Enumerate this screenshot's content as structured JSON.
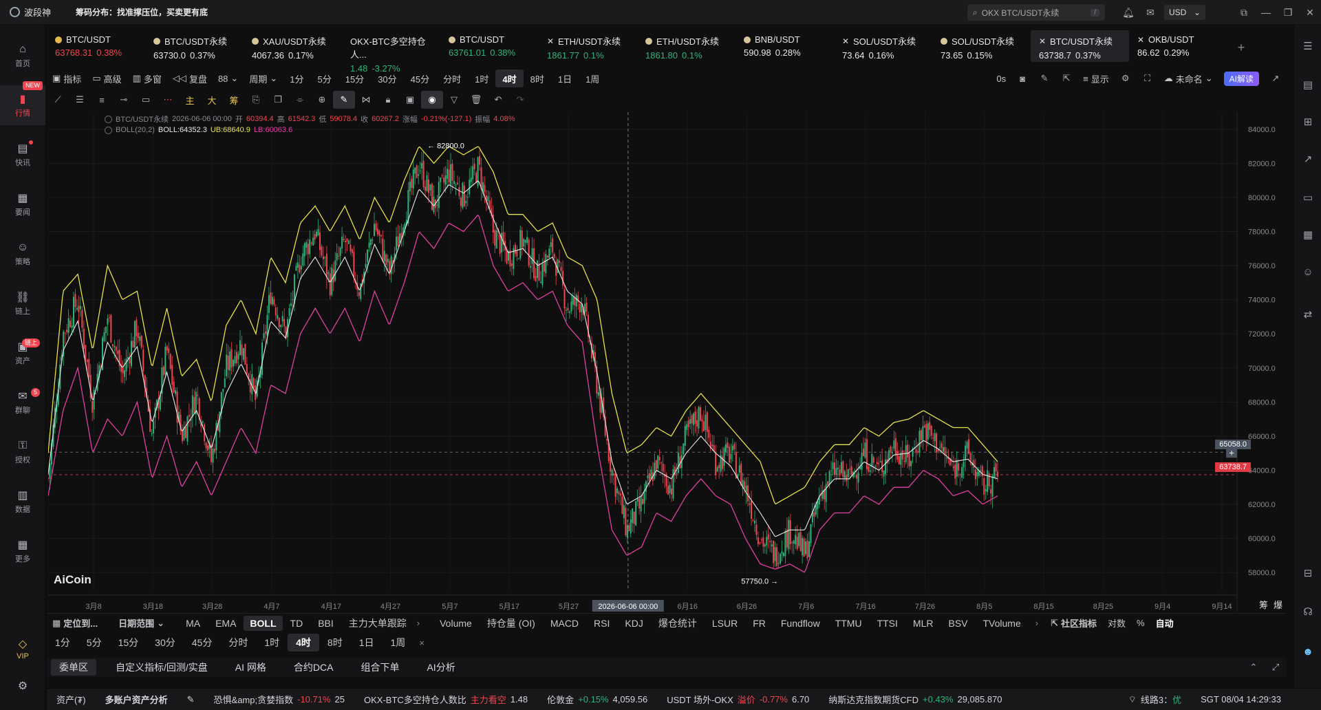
{
  "app": {
    "name": "波段神",
    "slogan": "筹码分布：找准撑压位，买卖更有底"
  },
  "titlebar": {
    "search_placeholder": "OKX BTC/USDT永续",
    "search_key": "/",
    "currency": "USD"
  },
  "leftbar": [
    {
      "label": "首页",
      "icon": "home-icon"
    },
    {
      "label": "行情",
      "icon": "chart-bar-icon",
      "active": true,
      "badge": "NEW"
    },
    {
      "label": "快讯",
      "icon": "news-icon",
      "dot": true
    },
    {
      "label": "要闻",
      "icon": "document-icon"
    },
    {
      "label": "策略",
      "icon": "robot-icon"
    },
    {
      "label": "链上",
      "icon": "chain-icon"
    },
    {
      "label": "资产",
      "icon": "wallet-icon",
      "badge": "链上"
    },
    {
      "label": "群聊",
      "icon": "chat-icon",
      "badge": "5"
    },
    {
      "label": "授权",
      "icon": "key-icon"
    },
    {
      "label": "数据",
      "icon": "data-icon"
    },
    {
      "label": "更多",
      "icon": "grid-icon"
    }
  ],
  "vip": "VIP",
  "tabs": [
    {
      "name": "BTC/USDT",
      "price": "63768.31",
      "change": "0.38%",
      "dir": "up",
      "icon": "coin"
    },
    {
      "name": "BTC/USDT永续",
      "price": "63730.0",
      "change": "0.37%",
      "dir": "neutral",
      "icon": "dot"
    },
    {
      "name": "XAU/USDT永续",
      "price": "4067.36",
      "change": "0.17%",
      "dir": "neutral",
      "icon": "dot"
    },
    {
      "name": "OKX-BTC多空持仓人...",
      "price": "1.48",
      "change": "-3.27%",
      "dir": "down",
      "icon": "none"
    },
    {
      "name": "BTC/USDT",
      "price": "63761.01",
      "change": "0.38%",
      "dir": "down",
      "icon": "dot"
    },
    {
      "name": "ETH/USDT永续",
      "price": "1861.77",
      "change": "0.1%",
      "dir": "down",
      "icon": "x"
    },
    {
      "name": "ETH/USDT永续",
      "price": "1861.80",
      "change": "0.1%",
      "dir": "down",
      "icon": "dot"
    },
    {
      "name": "BNB/USDT",
      "price": "590.98",
      "change": "0.28%",
      "dir": "neutral",
      "icon": "dot"
    },
    {
      "name": "SOL/USDT永续",
      "price": "73.64",
      "change": "0.16%",
      "dir": "neutral",
      "icon": "x"
    },
    {
      "name": "SOL/USDT永续",
      "price": "73.65",
      "change": "0.15%",
      "dir": "neutral",
      "icon": "dot"
    },
    {
      "name": "BTC/USDT永续",
      "price": "63738.7",
      "change": "0.37%",
      "dir": "neutral",
      "icon": "x",
      "active": true
    },
    {
      "name": "OKB/USDT",
      "price": "86.62",
      "change": "0.29%",
      "dir": "neutral",
      "icon": "x"
    }
  ],
  "toolbar1": {
    "indicator": "指标",
    "advanced": "高级",
    "multi": "多窗",
    "replay": "复盘",
    "layout": "88",
    "period_label": "周期",
    "periods": [
      "1分",
      "5分",
      "15分",
      "30分",
      "45分",
      "分时",
      "1时",
      "4时",
      "8时",
      "1日",
      "1周"
    ],
    "selected_period": "4时",
    "countdown": "0s",
    "display": "显示",
    "unnamed": "未命名",
    "ai": "AI解读"
  },
  "toolbar2_quick": [
    "主",
    "大",
    "筹"
  ],
  "chart_legend": {
    "symbol": "BTC/USDT永续",
    "date": "2026-06-06 00:00",
    "open_lbl": "开",
    "open": "60394.4",
    "high_lbl": "高",
    "high": "61542.3",
    "low_lbl": "低",
    "low": "59078.4",
    "close_lbl": "收",
    "close": "60267.2",
    "chg_lbl": "涨幅",
    "chg": "-0.21%(-127.1)",
    "amp_lbl": "振幅",
    "amp": "4.08%",
    "boll_name": "BOLL(20,2)",
    "boll_mid": "BOLL:64352.3",
    "boll_ub": "UB:68640.9",
    "boll_lb": "LB:60063.6"
  },
  "chart_data": {
    "type": "candlestick",
    "ylim": [
      57000,
      85000
    ],
    "y_ticks": [
      "84000.0",
      "82000.0",
      "80000.0",
      "78000.0",
      "76000.0",
      "74000.0",
      "72000.0",
      "70000.0",
      "68000.0",
      "66000.0",
      "64000.0",
      "62000.0",
      "60000.0",
      "58000.0"
    ],
    "x_ticks": [
      "3月8",
      "3月18",
      "3月28",
      "4月7",
      "4月17",
      "4月27",
      "5月7",
      "5月17",
      "5月27",
      "2026-06-06 00:00",
      "6月16",
      "6月26",
      "7月6",
      "7月16",
      "7月26",
      "8月5",
      "8月15",
      "8月25",
      "9月4",
      "9月14"
    ],
    "highlight_x": "2026-06-06 00:00",
    "close_path": [
      [
        0,
        63500
      ],
      [
        2,
        72000
      ],
      [
        4,
        74000
      ],
      [
        6,
        68000
      ],
      [
        8,
        73000
      ],
      [
        10,
        69500
      ],
      [
        12,
        72500
      ],
      [
        14,
        66000
      ],
      [
        16,
        71000
      ],
      [
        18,
        66000
      ],
      [
        20,
        68500
      ],
      [
        22,
        64500
      ],
      [
        24,
        70000
      ],
      [
        26,
        71500
      ],
      [
        28,
        68000
      ],
      [
        30,
        74500
      ],
      [
        32,
        72000
      ],
      [
        34,
        76500
      ],
      [
        36,
        78000
      ],
      [
        38,
        75000
      ],
      [
        40,
        77500
      ],
      [
        42,
        74500
      ],
      [
        44,
        78500
      ],
      [
        46,
        75500
      ],
      [
        48,
        79000
      ],
      [
        50,
        82000
      ],
      [
        52,
        79500
      ],
      [
        54,
        81500
      ],
      [
        56,
        80000
      ],
      [
        58,
        81800
      ],
      [
        60,
        78000
      ],
      [
        62,
        76500
      ],
      [
        64,
        77500
      ],
      [
        66,
        75500
      ],
      [
        68,
        77000
      ],
      [
        70,
        73500
      ],
      [
        72,
        74000
      ],
      [
        74,
        69000
      ],
      [
        76,
        64000
      ],
      [
        78,
        60500
      ],
      [
        80,
        62000
      ],
      [
        82,
        64500
      ],
      [
        84,
        63000
      ],
      [
        86,
        66000
      ],
      [
        88,
        67500
      ],
      [
        90,
        64500
      ],
      [
        92,
        65000
      ],
      [
        94,
        63000
      ],
      [
        96,
        60000
      ],
      [
        98,
        59000
      ],
      [
        100,
        60500
      ],
      [
        102,
        59000
      ],
      [
        104,
        62500
      ],
      [
        106,
        64000
      ],
      [
        108,
        63500
      ],
      [
        110,
        65000
      ],
      [
        112,
        64000
      ],
      [
        114,
        65500
      ],
      [
        116,
        64500
      ],
      [
        118,
        66500
      ],
      [
        120,
        65500
      ],
      [
        122,
        64000
      ],
      [
        124,
        65000
      ],
      [
        126,
        63000
      ],
      [
        128,
        63738
      ]
    ],
    "ub_path": [
      [
        0,
        65000
      ],
      [
        2,
        74500
      ],
      [
        4,
        75500
      ],
      [
        6,
        71000
      ],
      [
        8,
        76000
      ],
      [
        10,
        74000
      ],
      [
        12,
        74500
      ],
      [
        14,
        70000
      ],
      [
        16,
        73500
      ],
      [
        18,
        69500
      ],
      [
        20,
        70500
      ],
      [
        22,
        68000
      ],
      [
        24,
        72500
      ],
      [
        26,
        74000
      ],
      [
        28,
        72000
      ],
      [
        30,
        76500
      ],
      [
        32,
        75000
      ],
      [
        34,
        78500
      ],
      [
        36,
        79500
      ],
      [
        38,
        78000
      ],
      [
        40,
        79500
      ],
      [
        42,
        77500
      ],
      [
        44,
        80000
      ],
      [
        46,
        78500
      ],
      [
        48,
        81000
      ],
      [
        50,
        83000
      ],
      [
        52,
        82000
      ],
      [
        54,
        83000
      ],
      [
        56,
        82500
      ],
      [
        58,
        83000
      ],
      [
        60,
        81500
      ],
      [
        62,
        79000
      ],
      [
        64,
        79000
      ],
      [
        66,
        78000
      ],
      [
        68,
        78500
      ],
      [
        70,
        76500
      ],
      [
        72,
        76000
      ],
      [
        74,
        74000
      ],
      [
        76,
        68500
      ],
      [
        78,
        65000
      ],
      [
        80,
        65500
      ],
      [
        82,
        66500
      ],
      [
        84,
        66000
      ],
      [
        86,
        67500
      ],
      [
        88,
        68500
      ],
      [
        90,
        67500
      ],
      [
        92,
        66500
      ],
      [
        94,
        65500
      ],
      [
        96,
        64500
      ],
      [
        98,
        62000
      ],
      [
        100,
        62500
      ],
      [
        102,
        63000
      ],
      [
        104,
        64500
      ],
      [
        106,
        65500
      ],
      [
        108,
        65500
      ],
      [
        110,
        66500
      ],
      [
        112,
        66000
      ],
      [
        114,
        66800
      ],
      [
        116,
        67000
      ],
      [
        118,
        67500
      ],
      [
        120,
        67000
      ],
      [
        122,
        66500
      ],
      [
        124,
        66500
      ],
      [
        126,
        65500
      ],
      [
        128,
        64500
      ]
    ],
    "lb_path": [
      [
        0,
        62500
      ],
      [
        2,
        67500
      ],
      [
        4,
        70000
      ],
      [
        6,
        65000
      ],
      [
        8,
        67000
      ],
      [
        10,
        66000
      ],
      [
        12,
        68000
      ],
      [
        14,
        63500
      ],
      [
        16,
        66000
      ],
      [
        18,
        63000
      ],
      [
        20,
        64500
      ],
      [
        22,
        62500
      ],
      [
        24,
        64500
      ],
      [
        26,
        66500
      ],
      [
        28,
        65000
      ],
      [
        30,
        69000
      ],
      [
        32,
        68500
      ],
      [
        34,
        72000
      ],
      [
        36,
        73500
      ],
      [
        38,
        72000
      ],
      [
        40,
        73500
      ],
      [
        42,
        71500
      ],
      [
        44,
        74500
      ],
      [
        46,
        72500
      ],
      [
        48,
        75000
      ],
      [
        50,
        78000
      ],
      [
        52,
        77000
      ],
      [
        54,
        78500
      ],
      [
        56,
        78000
      ],
      [
        58,
        79000
      ],
      [
        60,
        76000
      ],
      [
        62,
        74500
      ],
      [
        64,
        75000
      ],
      [
        66,
        74000
      ],
      [
        68,
        74500
      ],
      [
        70,
        72500
      ],
      [
        72,
        71500
      ],
      [
        74,
        65500
      ],
      [
        76,
        60500
      ],
      [
        78,
        59000
      ],
      [
        80,
        59500
      ],
      [
        82,
        61500
      ],
      [
        84,
        61000
      ],
      [
        86,
        62500
      ],
      [
        88,
        63500
      ],
      [
        90,
        62500
      ],
      [
        92,
        62000
      ],
      [
        94,
        60000
      ],
      [
        96,
        58500
      ],
      [
        98,
        58200
      ],
      [
        100,
        58500
      ],
      [
        102,
        58000
      ],
      [
        104,
        60500
      ],
      [
        106,
        61500
      ],
      [
        108,
        61500
      ],
      [
        110,
        62500
      ],
      [
        112,
        62000
      ],
      [
        114,
        63000
      ],
      [
        116,
        63000
      ],
      [
        118,
        64000
      ],
      [
        120,
        63500
      ],
      [
        122,
        62500
      ],
      [
        124,
        62800
      ],
      [
        126,
        62000
      ],
      [
        128,
        62500
      ]
    ],
    "max_label": "82800.0",
    "min_label": "57750.0",
    "crosshair_price": "65058.0",
    "last_price": "63738.7",
    "watermark": "AiCoin",
    "right_labels": [
      "筹",
      "爆"
    ],
    "colors": {
      "up": "#2fb37a",
      "down": "#f0454f",
      "ub": "#e6e24a",
      "mid": "#e8e8ea",
      "lb": "#e040a0"
    }
  },
  "indbar": {
    "locate": "定位到...",
    "range": "日期范围",
    "main": [
      "MA",
      "EMA",
      "BOLL",
      "TD",
      "BBI",
      "主力大单跟踪"
    ],
    "selected_main": "BOLL",
    "sub": [
      "Volume",
      "持仓量 (OI)",
      "MACD",
      "RSI",
      "KDJ",
      "爆仓统计",
      "LSUR",
      "FR",
      "Fundflow",
      "TTMU",
      "TTSI",
      "MLR",
      "BSV",
      "TVolume"
    ],
    "community": "社区指标",
    "log": "对数",
    "pct": "%",
    "auto": "自动"
  },
  "perbar": {
    "periods": [
      "1分",
      "5分",
      "15分",
      "30分",
      "45分",
      "分时",
      "1时",
      "4时",
      "8时",
      "1日",
      "1周"
    ],
    "selected": "4时"
  },
  "panel_tabs": [
    "委单区",
    "自定义指标/回测/实盘",
    "AI 网格",
    "合约DCA",
    "组合下单",
    "AI分析"
  ],
  "status": {
    "assets": "资产(₮)",
    "multi_account": "多账户资产分析",
    "fear_label": "恐惧&amp;贪婪指数",
    "fear_change": "-10.71%",
    "fear_value": "25",
    "ls_label": "OKX-BTC多空持仓人数比",
    "ls_note": "主力看空",
    "ls_value": "1.48",
    "gold_label": "伦敦金",
    "gold_change": "+0.15%",
    "gold_value": "4,059.56",
    "usdt_label": "USDT 场外-OKX",
    "usdt_note": "溢价",
    "usdt_change": "-0.77%",
    "usdt_value": "6.70",
    "nasdaq_label": "纳斯达克指数期货CFD",
    "nasdaq_change": "+0.43%",
    "nasdaq_value": "29,085.870",
    "line": "线路3：",
    "line_quality": "优",
    "clock": "SGT 08/04 14:29:33"
  }
}
